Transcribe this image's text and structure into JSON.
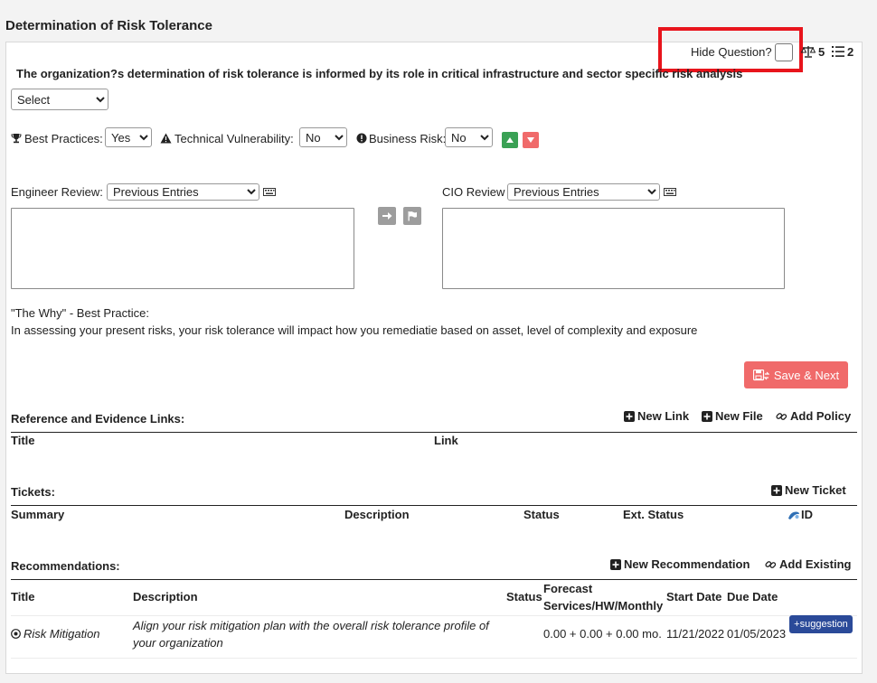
{
  "page": {
    "title": "Determination of Risk Tolerance"
  },
  "header": {
    "hide_question_label": "Hide Question?",
    "weight_value": "5",
    "list_count": "2"
  },
  "question": {
    "text": "The organization?s determination of risk tolerance is informed by its role in critical infrastructure and sector specific risk analysis",
    "answer_selected": "Select"
  },
  "ratings": {
    "best_practices_label": "Best Practices:",
    "best_practices_value": "Yes",
    "tech_vuln_label": "Technical Vulnerability:",
    "tech_vuln_value": "No",
    "business_risk_label": "Business Risk:",
    "business_risk_value": "No"
  },
  "reviews": {
    "engineer_label": "Engineer Review:",
    "engineer_select": "Previous Entries",
    "cio_label": "CIO Review",
    "cio_select": "Previous Entries"
  },
  "why": {
    "heading": "\"The Why\" - Best Practice:",
    "text": "In assessing your present risks, your risk tolerance will impact how you remediatie based on asset, level of complexity and exposure"
  },
  "save_label": "Save & Next",
  "references": {
    "title": "Reference and Evidence Links:",
    "new_link": "New Link",
    "new_file": "New File",
    "add_policy": "Add Policy",
    "columns": [
      "Title",
      "Link"
    ]
  },
  "tickets": {
    "title": "Tickets:",
    "new_ticket": "New Ticket",
    "columns": [
      "Summary",
      "Description",
      "Status",
      "Ext. Status",
      "ID"
    ]
  },
  "recommendations": {
    "title": "Recommendations:",
    "new_recommendation": "New Recommendation",
    "add_existing": "Add Existing",
    "columns": [
      "Title",
      "Description",
      "Status",
      "Forecast",
      "Services/HW/Monthly",
      "Start Date",
      "Due Date"
    ],
    "rows": [
      {
        "title": "Risk Mitigation",
        "description_line1": "Align your risk mitigation plan with the overall risk tolerance profile of",
        "description_line2": "your organization",
        "status": "",
        "forecast": "0.00 + 0.00 + 0.00 mo.",
        "start_date": "11/21/2022",
        "due_date": "01/05/2023",
        "suggestion_label": "+suggestion"
      }
    ]
  },
  "colors": {
    "highlight_red": "#e8141c",
    "up_green": "#3aa155",
    "down_red": "#f06a6a",
    "save_red": "#f06a6a",
    "suggestion_blue": "#2b4a99"
  }
}
